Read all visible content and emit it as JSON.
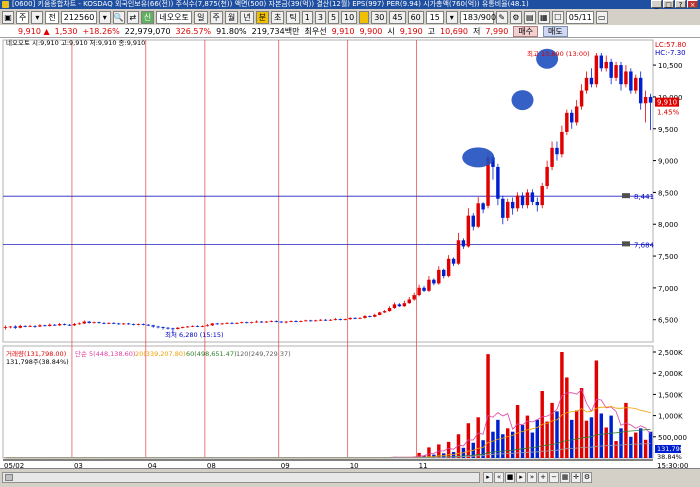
{
  "window": {
    "title": "[0600] 키움종합차트 - KOSDAQ 외국인보유(66(전)) 주식수(7,875(천)) 액면(500) 자본금(39(억)) 결산(12월) EPS(997) PER(9.94) 시가총액(760(억)) 유통비율(48.1)",
    "buttons": [
      "_",
      "□",
      "×",
      "?"
    ]
  },
  "toolbar": {
    "market": "주",
    "market2": "전",
    "code": "212560",
    "search_icon": "search-icon",
    "name_tag": "신",
    "name": "네오오토",
    "periods": [
      "일",
      "주",
      "월",
      "년"
    ],
    "units": [
      "분",
      "초",
      "틱"
    ],
    "intervals": [
      "1",
      "3",
      "5",
      "10",
      "",
      "30",
      "45",
      "60"
    ],
    "interval_value": "15",
    "count": "183",
    "count_total": "900",
    "date": "05/11"
  },
  "info": {
    "price": "9,910",
    "arrow": "▲",
    "change": "1,530",
    "change_pct": "+18.26%",
    "volume": "22,979,070",
    "vol_ratio": "326.57%",
    "ratio2": "91.80%",
    "amount": "219,734백만",
    "best_ask_label": "최우선",
    "ask": "9,910",
    "bid": "9,900",
    "open_label": "시",
    "open": "9,190",
    "high_label": "고",
    "high": "10,690",
    "low_label": "저",
    "low": "7,990",
    "buy_button": "매수",
    "sell_button": "매도"
  },
  "price_panel": {
    "legend": "네오오토 시:9,910 고:9,910 저:9,910 종:9,910",
    "max_label": "최고 10,690 (13:00)",
    "min_label": "최저 6,280 (15:15)",
    "lc": "LC:57.80",
    "hc": "HC:-7.30",
    "current": "9,910",
    "current_pct": "1.45%",
    "line1": "8,441",
    "line2": "7,684",
    "yticks": [
      "10,500",
      "10,000",
      "9,500",
      "9,000",
      "8,500",
      "8,000",
      "7,500",
      "7,000",
      "6,500"
    ]
  },
  "volume_panel": {
    "legend_name": "거래량(131,798.00)",
    "ma5": "단순 5(448,138.60)",
    "ma20": "20(339,207.80)",
    "ma60": "60(498,651.47)",
    "ma120": "120(249,729.37)",
    "sub_legend": "131,798주(38.84%)",
    "current": "131,798",
    "current_pct": "38.84%",
    "yticks": [
      "2,500K",
      "2,000K",
      "1,500K",
      "1,000K",
      "500,000"
    ]
  },
  "x_axis": {
    "labels": [
      "05/02",
      "03",
      "04",
      "08",
      "09",
      "10",
      "11"
    ],
    "time": "15:30:00"
  },
  "chart_data": {
    "type": "candlestick",
    "title": "네오오토 (212560) 15분봉",
    "price_range": [
      6150,
      10800
    ],
    "volume_range": [
      0,
      2500
    ],
    "volume_unit": "K",
    "day_dividers": [
      "03",
      "04",
      "08",
      "09",
      "10",
      "11"
    ],
    "horizontal_lines": [
      8441,
      7684
    ],
    "high": 10690,
    "low": 6280,
    "close": 9910,
    "candles": [
      [
        6374,
        6383,
        6412,
        6345,
        1
      ],
      [
        6383,
        6393,
        6402,
        6364,
        1
      ],
      [
        6393,
        6374,
        6412,
        6355,
        -1
      ],
      [
        6374,
        6402,
        6421,
        6364,
        1
      ],
      [
        6402,
        6393,
        6412,
        6383,
        -1
      ],
      [
        6393,
        6402,
        6421,
        6383,
        1
      ],
      [
        6402,
        6393,
        6412,
        6374,
        -1
      ],
      [
        6393,
        6412,
        6431,
        6383,
        1
      ],
      [
        6412,
        6402,
        6421,
        6393,
        -1
      ],
      [
        6402,
        6421,
        6441,
        6393,
        1
      ],
      [
        6421,
        6412,
        6431,
        6402,
        -1
      ],
      [
        6412,
        6431,
        6450,
        6402,
        1
      ],
      [
        6431,
        6421,
        6441,
        6412,
        -1
      ],
      [
        6421,
        6412,
        6431,
        6402,
        -1
      ],
      [
        6412,
        6431,
        6450,
        6402,
        1
      ],
      [
        6431,
        6441,
        6460,
        6421,
        1
      ],
      [
        6441,
        6470,
        6489,
        6431,
        1
      ],
      [
        6470,
        6450,
        6479,
        6441,
        -1
      ],
      [
        6450,
        6460,
        6470,
        6441,
        1
      ],
      [
        6460,
        6450,
        6470,
        6441,
        -1
      ],
      [
        6450,
        6441,
        6460,
        6431,
        -1
      ],
      [
        6441,
        6450,
        6460,
        6431,
        1
      ],
      [
        6450,
        6441,
        6460,
        6431,
        -1
      ],
      [
        6441,
        6431,
        6450,
        6421,
        -1
      ],
      [
        6431,
        6441,
        6450,
        6421,
        1
      ],
      [
        6441,
        6431,
        6450,
        6421,
        -1
      ],
      [
        6431,
        6421,
        6441,
        6412,
        -1
      ],
      [
        6421,
        6431,
        6441,
        6412,
        1
      ],
      [
        6431,
        6421,
        6441,
        6412,
        -1
      ],
      [
        6421,
        6412,
        6431,
        6402,
        -1
      ],
      [
        6412,
        6393,
        6421,
        6374,
        -1
      ],
      [
        6393,
        6383,
        6402,
        6364,
        -1
      ],
      [
        6383,
        6374,
        6393,
        6345,
        -1
      ],
      [
        6374,
        6364,
        6383,
        6345,
        -1
      ],
      [
        6364,
        6355,
        6374,
        6280,
        -1
      ],
      [
        6355,
        6374,
        6383,
        6345,
        1
      ],
      [
        6374,
        6383,
        6393,
        6364,
        1
      ],
      [
        6383,
        6393,
        6402,
        6374,
        1
      ],
      [
        6393,
        6402,
        6412,
        6383,
        1
      ],
      [
        6402,
        6393,
        6412,
        6383,
        -1
      ],
      [
        6393,
        6402,
        6412,
        6383,
        1
      ],
      [
        6402,
        6412,
        6431,
        6393,
        1
      ],
      [
        6412,
        6441,
        6450,
        6402,
        1
      ],
      [
        6441,
        6431,
        6450,
        6421,
        -1
      ],
      [
        6431,
        6441,
        6450,
        6421,
        1
      ],
      [
        6441,
        6450,
        6460,
        6431,
        1
      ],
      [
        6450,
        6441,
        6460,
        6431,
        -1
      ],
      [
        6441,
        6450,
        6460,
        6431,
        1
      ],
      [
        6450,
        6460,
        6470,
        6441,
        1
      ],
      [
        6460,
        6450,
        6470,
        6441,
        -1
      ],
      [
        6450,
        6460,
        6470,
        6441,
        1
      ],
      [
        6460,
        6470,
        6489,
        6450,
        1
      ],
      [
        6470,
        6460,
        6479,
        6450,
        -1
      ],
      [
        6460,
        6470,
        6479,
        6450,
        1
      ],
      [
        6470,
        6479,
        6489,
        6460,
        1
      ],
      [
        6479,
        6470,
        6489,
        6460,
        -1
      ],
      [
        6470,
        6460,
        6479,
        6450,
        -1
      ],
      [
        6460,
        6470,
        6479,
        6441,
        1
      ],
      [
        6470,
        6479,
        6489,
        6460,
        1
      ],
      [
        6479,
        6470,
        6489,
        6460,
        -1
      ],
      [
        6470,
        6479,
        6489,
        6460,
        1
      ],
      [
        6479,
        6489,
        6499,
        6470,
        1
      ],
      [
        6489,
        6479,
        6499,
        6470,
        -1
      ],
      [
        6479,
        6489,
        6499,
        6470,
        1
      ],
      [
        6489,
        6499,
        6509,
        6479,
        1
      ],
      [
        6499,
        6489,
        6509,
        6479,
        -1
      ],
      [
        6489,
        6499,
        6509,
        6479,
        1
      ],
      [
        6499,
        6509,
        6528,
        6489,
        1
      ],
      [
        6509,
        6499,
        6518,
        6489,
        -1
      ],
      [
        6499,
        6509,
        6518,
        6489,
        1
      ],
      [
        6509,
        6528,
        6538,
        6499,
        1
      ],
      [
        6528,
        6518,
        6538,
        6509,
        -1
      ],
      [
        6518,
        6528,
        6538,
        6509,
        1
      ],
      [
        6528,
        6557,
        6576,
        6518,
        1
      ],
      [
        6557,
        6547,
        6567,
        6538,
        -1
      ],
      [
        6547,
        6576,
        6596,
        6538,
        1
      ],
      [
        6576,
        6615,
        6625,
        6567,
        1
      ],
      [
        6615,
        6635,
        6654,
        6605,
        1
      ],
      [
        6635,
        6683,
        6712,
        6625,
        1
      ],
      [
        6683,
        6741,
        6770,
        6673,
        1
      ],
      [
        6741,
        6712,
        6760,
        6702,
        -1
      ],
      [
        6712,
        6760,
        6799,
        6702,
        1
      ],
      [
        6760,
        6818,
        6857,
        6750,
        1
      ],
      [
        6818,
        6887,
        6926,
        6799,
        1
      ],
      [
        6887,
        7002,
        7050,
        6867,
        1
      ],
      [
        7002,
        6954,
        7032,
        6935,
        -1
      ],
      [
        6954,
        7128,
        7186,
        6935,
        1
      ],
      [
        7128,
        7070,
        7148,
        7041,
        -1
      ],
      [
        7070,
        7283,
        7341,
        7050,
        1
      ],
      [
        7283,
        7186,
        7302,
        7148,
        -1
      ],
      [
        7186,
        7457,
        7515,
        7167,
        1
      ],
      [
        7457,
        7380,
        7477,
        7341,
        -1
      ],
      [
        7380,
        7748,
        7864,
        7361,
        1
      ],
      [
        7748,
        7651,
        7777,
        7612,
        -1
      ],
      [
        7651,
        8135,
        8252,
        7632,
        1
      ],
      [
        8135,
        7961,
        8174,
        7903,
        -1
      ],
      [
        7961,
        8329,
        8426,
        7942,
        1
      ],
      [
        8329,
        8232,
        8348,
        8174,
        -1
      ],
      [
        8290,
        9050,
        9130,
        8250,
        1
      ],
      [
        9050,
        8900,
        9100,
        8700,
        -1
      ],
      [
        8900,
        8400,
        8950,
        8300,
        -1
      ],
      [
        8400,
        8100,
        8450,
        8000,
        -1
      ],
      [
        8100,
        8350,
        8400,
        8050,
        1
      ],
      [
        8350,
        8250,
        8420,
        8150,
        -1
      ],
      [
        8250,
        8450,
        8500,
        8200,
        1
      ],
      [
        8450,
        8300,
        8500,
        8250,
        -1
      ],
      [
        8300,
        8500,
        8550,
        8250,
        1
      ],
      [
        8500,
        8350,
        8550,
        8300,
        -1
      ],
      [
        8350,
        8300,
        8420,
        8200,
        -1
      ],
      [
        8300,
        8600,
        8650,
        8250,
        1
      ],
      [
        8600,
        8900,
        9000,
        8550,
        1
      ],
      [
        8900,
        9200,
        9300,
        8850,
        1
      ],
      [
        9200,
        9100,
        9300,
        9000,
        -1
      ],
      [
        9100,
        9450,
        9550,
        9050,
        1
      ],
      [
        9450,
        9750,
        9800,
        9400,
        1
      ],
      [
        9750,
        9600,
        9800,
        9500,
        -1
      ],
      [
        9600,
        9850,
        9950,
        9550,
        1
      ],
      [
        9850,
        10100,
        10200,
        9800,
        1
      ],
      [
        10100,
        10300,
        10400,
        10050,
        1
      ],
      [
        10300,
        10200,
        10450,
        10150,
        -1
      ],
      [
        10200,
        10650,
        10690,
        10150,
        1
      ],
      [
        10650,
        10450,
        10690,
        10400,
        -1
      ],
      [
        10450,
        10550,
        10650,
        10400,
        1
      ],
      [
        10550,
        10300,
        10600,
        10200,
        -1
      ],
      [
        10300,
        10500,
        10550,
        10250,
        1
      ],
      [
        10500,
        10200,
        10550,
        10100,
        -1
      ],
      [
        10200,
        10400,
        10500,
        10150,
        1
      ],
      [
        10400,
        10100,
        10450,
        10050,
        -1
      ],
      [
        10100,
        10300,
        10350,
        10050,
        1
      ],
      [
        10300,
        9900,
        10400,
        9800,
        -1
      ],
      [
        9900,
        10000,
        10100,
        9600,
        1
      ],
      [
        10000,
        9910,
        10050,
        9480,
        -1
      ]
    ],
    "volumes": [
      8,
      5,
      6,
      9,
      5,
      6,
      7,
      5,
      6,
      8,
      5,
      7,
      6,
      5,
      9,
      12,
      18,
      10,
      8,
      7,
      6,
      7,
      6,
      5,
      6,
      7,
      6,
      8,
      7,
      9,
      12,
      14,
      10,
      11,
      18,
      10,
      8,
      7,
      6,
      5,
      6,
      7,
      10,
      8,
      7,
      6,
      5,
      6,
      7,
      6,
      5,
      8,
      7,
      6,
      7,
      6,
      5,
      6,
      7,
      6,
      5,
      8,
      7,
      6,
      7,
      8,
      6,
      7,
      8,
      6,
      7,
      9,
      8,
      7,
      9,
      8,
      14,
      20,
      22,
      25,
      16,
      22,
      24,
      30,
      120,
      60,
      250,
      80,
      320,
      110,
      380,
      140,
      560,
      240,
      820,
      360,
      960,
      420,
      2450,
      620,
      900,
      560,
      700,
      620,
      1250,
      780,
      1000,
      600,
      900,
      1580,
      860,
      1300,
      1100,
      2500,
      1900,
      900,
      1120,
      1650,
      880,
      960,
      2300,
      1050,
      720,
      1000,
      400,
      700,
      1300,
      500,
      600,
      700,
      430,
      620
    ]
  }
}
